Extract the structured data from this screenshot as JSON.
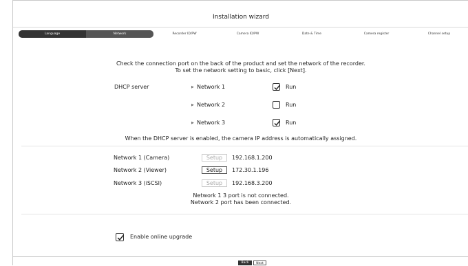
{
  "window": {
    "title": "Installation wizard"
  },
  "steps": [
    {
      "label": "Language"
    },
    {
      "label": "Network"
    },
    {
      "label": "Recorder ID/PW"
    },
    {
      "label": "Camera ID/PW"
    },
    {
      "label": "Date & Time"
    },
    {
      "label": "Camera register"
    },
    {
      "label": "Channel setup"
    }
  ],
  "intro": {
    "line1": "Check the connection port on the back of the product and set the network of the recorder.",
    "line2": "To set the network setting to basic, click [Next]."
  },
  "dhcp": {
    "label": "DHCP server",
    "run_label": "Run",
    "networks": [
      {
        "name": "Network 1",
        "checked": true
      },
      {
        "name": "Network 2",
        "checked": false
      },
      {
        "name": "Network 3",
        "checked": true
      }
    ],
    "note": "When the DHCP server is enabled, the camera IP address is automatically assigned."
  },
  "ports": [
    {
      "name": "Network 1 (Camera)",
      "setup_label": "Setup",
      "setup_enabled": false,
      "ip": "192.168.1.200"
    },
    {
      "name": "Network 2 (Viewer)",
      "setup_label": "Setup",
      "setup_enabled": true,
      "ip": "172.30.1.196"
    },
    {
      "name": "Network 3 (iSCSI)",
      "setup_label": "Setup",
      "setup_enabled": false,
      "ip": "192.168.3.200"
    }
  ],
  "connection_status": {
    "line1": "Network 1 3  port is not connected.",
    "line2": "Network 2  port has been connected."
  },
  "upgrade": {
    "label": "Enable online upgrade",
    "checked": true
  },
  "nav": {
    "back_label": "Back",
    "next_label": "Next"
  }
}
